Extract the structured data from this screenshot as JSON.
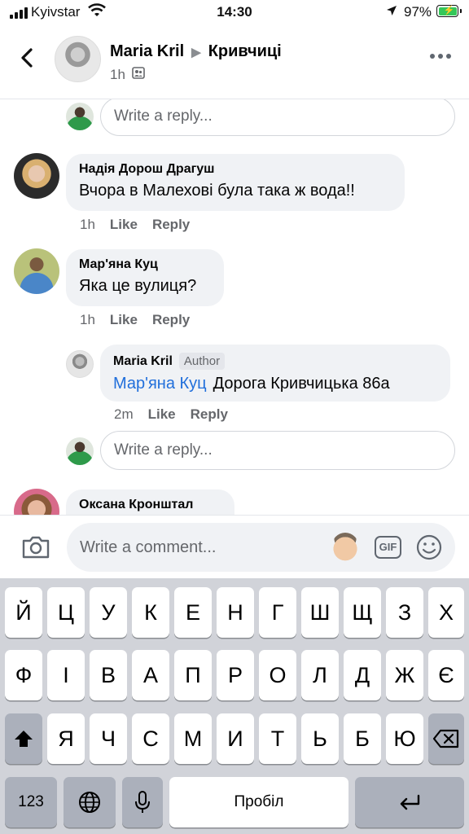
{
  "status_bar": {
    "carrier": "Kyivstar",
    "time": "14:30",
    "battery": "97%"
  },
  "header": {
    "author": "Maria Kril",
    "group": "Кривчиці",
    "time": "1h"
  },
  "feed": {
    "reply_placeholder": "Write a reply...",
    "comments": [
      {
        "name": "Надія Дорош Драгуш",
        "text": "Вчора в Малехові була така ж вода!!",
        "time": "1h",
        "like": "Like",
        "reply": "Reply"
      },
      {
        "name": "Мар'яна Куц",
        "text": "Яка це вулиця?",
        "time": "1h",
        "like": "Like",
        "reply": "Reply"
      },
      {
        "name": "Оксана Кронштал"
      }
    ],
    "nested_reply": {
      "name": "Maria Kril",
      "badge": "Author",
      "mention": "Мар'яна Куц",
      "text": "Дорога Кривчицька 86а",
      "time": "2m",
      "like": "Like",
      "reply": "Reply"
    }
  },
  "comment_bar": {
    "placeholder": "Write a comment...",
    "gif": "GIF"
  },
  "keyboard": {
    "row1": [
      "Й",
      "Ц",
      "У",
      "К",
      "Е",
      "Н",
      "Г",
      "Ш",
      "Щ",
      "З",
      "Х"
    ],
    "row2": [
      "Ф",
      "І",
      "В",
      "А",
      "П",
      "Р",
      "О",
      "Л",
      "Д",
      "Ж",
      "Є"
    ],
    "row3": [
      "Я",
      "Ч",
      "С",
      "М",
      "И",
      "Т",
      "Ь",
      "Б",
      "Ю"
    ],
    "numbers_key": "123",
    "space_key": "Пробіл"
  },
  "colors": {
    "accent_link": "#216fdb",
    "bubble": "#f0f2f5",
    "keyboard_bg": "#d1d3d9"
  }
}
